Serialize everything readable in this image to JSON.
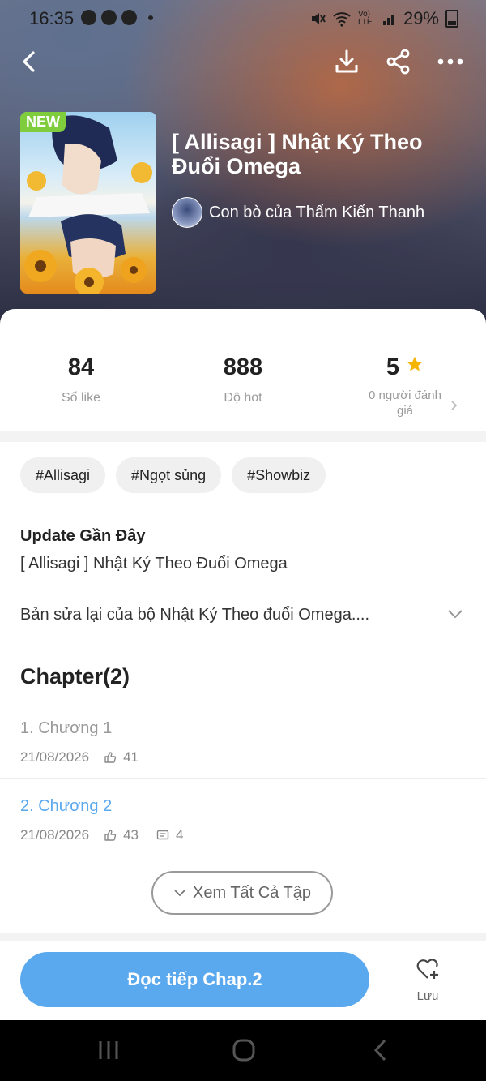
{
  "status_bar": {
    "time": "16:35",
    "battery": "29%",
    "network_badge": "Vo) LTE"
  },
  "header": {
    "back_icon": "back-arrow-icon",
    "download_icon": "download-icon",
    "share_icon": "share-icon",
    "more_icon": "more-dots-icon"
  },
  "comic": {
    "badge": "NEW",
    "title": "[ Allisagi ] Nhật Ký Theo Đuổi Omega",
    "author": "Con bò của Thẩm Kiến Thanh"
  },
  "stats": [
    {
      "value": "84",
      "label": "Số like"
    },
    {
      "value": "888",
      "label": "Độ hot"
    },
    {
      "value": "5",
      "label": "0 người đánh giá"
    }
  ],
  "tags": [
    "#Allisagi",
    "#Ngọt sủng",
    "#Showbiz"
  ],
  "update": {
    "title": "Update Gần Đây",
    "subtitle": "[ Allisagi ] Nhật Ký Theo Đuổi Omega"
  },
  "description": "Bản sửa lại của bộ Nhật Ký Theo đuổi Omega....",
  "chapters": {
    "heading": "Chapter(2)",
    "items": [
      {
        "title": "1. Chương 1",
        "date": "21/08/2026",
        "likes": "41",
        "comments": "",
        "color": "#999999"
      },
      {
        "title": "2. Chương 2",
        "date": "21/08/2026",
        "likes": "43",
        "comments": "4",
        "color": "#5aa8ee"
      }
    ],
    "see_all": "Xem Tất Cả Tập"
  },
  "actions": {
    "read_button": "Đọc tiếp Chap.2",
    "save_label": "Lưu",
    "accent": "#5aa8ee",
    "star": "#f5b400"
  }
}
